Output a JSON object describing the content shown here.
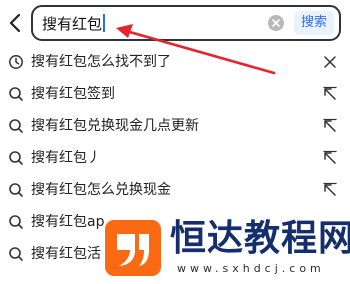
{
  "search": {
    "query": "搜有红包",
    "submit_label": "搜索"
  },
  "suggestions": [
    {
      "text": "搜有红包怎么找不到了",
      "lead_icon": "history-clock-icon",
      "trail_icon": "delete-x-icon"
    },
    {
      "text": "搜有红包签到",
      "lead_icon": "search-icon",
      "trail_icon": "fill-arrow-icon"
    },
    {
      "text": "搜有红包兑换现金几点更新",
      "lead_icon": "search-icon",
      "trail_icon": "fill-arrow-icon"
    },
    {
      "text": "搜有红包丿",
      "lead_icon": "search-icon",
      "trail_icon": "fill-arrow-icon"
    },
    {
      "text": "搜有红包怎么兑换现金",
      "lead_icon": "search-icon",
      "trail_icon": "fill-arrow-icon"
    },
    {
      "text": "搜有红包ap",
      "lead_icon": "search-icon",
      "trail_icon": ""
    },
    {
      "text": "搜有红包活",
      "lead_icon": "search-icon",
      "trail_icon": ""
    }
  ],
  "watermark": {
    "site_name": "恒达教程网",
    "url": "www.sxhdcj.com"
  },
  "colors": {
    "accent_blue": "#2f6df6",
    "annotation_red": "#e5262c",
    "watermark_orange": "#fa6a13",
    "watermark_navy": "#152e6d"
  }
}
